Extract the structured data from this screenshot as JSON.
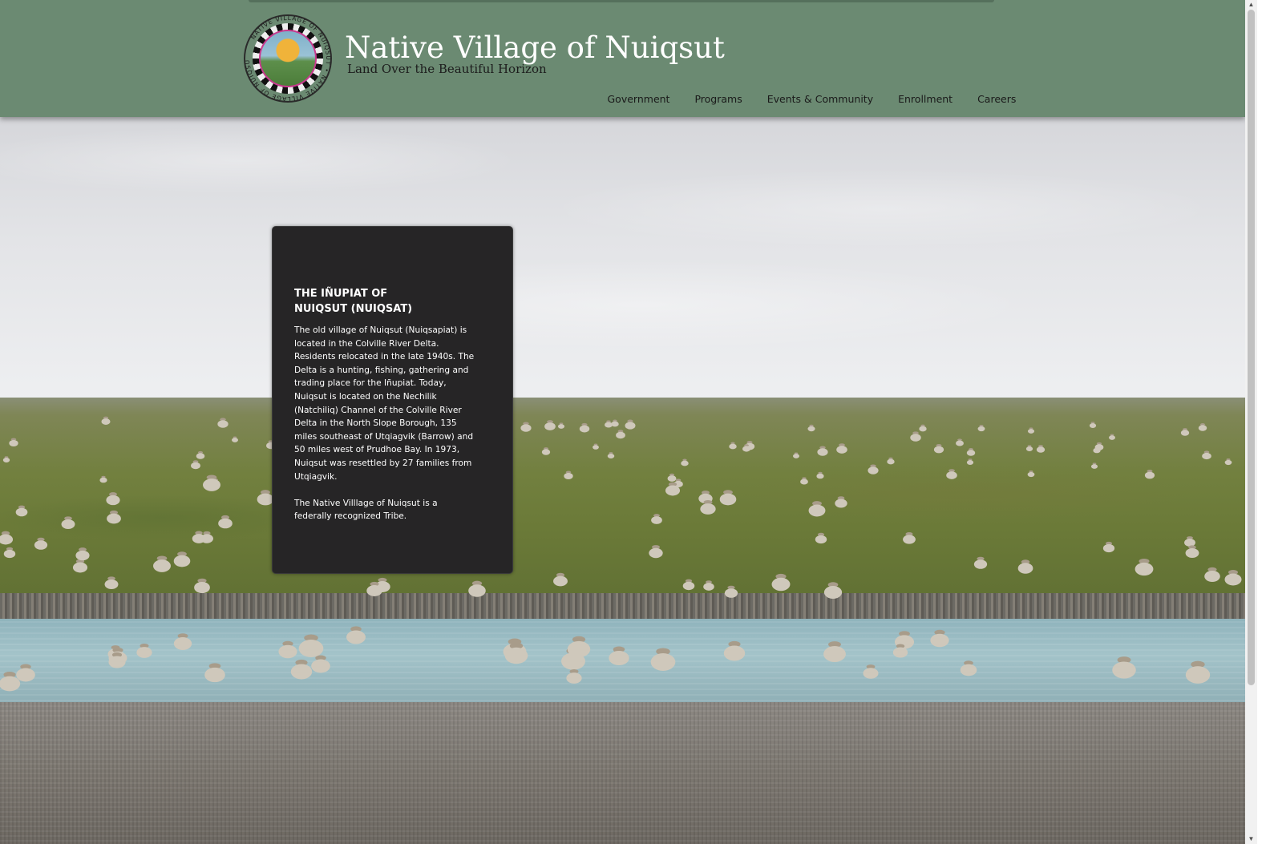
{
  "header": {
    "title": "Native Village of Nuiqsut",
    "tagline": "Land Over the Beautiful Horizon",
    "logo_icon": "tribal-seal-icon",
    "logo_text": "NATIVE VILLAGE OF NUIQSUT",
    "background_color": "#6b8a72"
  },
  "nav": {
    "items": [
      {
        "label": "Government"
      },
      {
        "label": "Programs"
      },
      {
        "label": "Events & Community"
      },
      {
        "label": "Enrollment"
      },
      {
        "label": "Careers"
      }
    ]
  },
  "card": {
    "title_line1": "THE IÑUPIAT OF",
    "title_line2": "NUIQSUT (NUIQSAT)",
    "paragraph1": "The old village of Nuiqsut (Nuiqsapiat) is located in the Colville River Delta. Residents relocated in the late 1940s. The Delta is a hunting, fishing, gathering and trading place for the Iñupiat. Today, Nuiqsut is located on the Nechilik (Natchiliq) Channel of the Colville River Delta in the North Slope Borough, 135 miles southeast of Utqiagvik (Barrow) and 50 miles west of Prudhoe Bay. In 1973, Nuiqsut was resettled by 27 families from Utqiagvik.",
    "paragraph2": "The Native Villlage of Nuiqsut is a federally recognized Tribe.",
    "background_color": "#262526"
  },
  "background": {
    "image_icon": "caribou-herd-river-photo"
  },
  "scrollbar": {
    "up_icon": "scroll-up-arrow-icon",
    "down_icon": "scroll-down-arrow-icon"
  }
}
